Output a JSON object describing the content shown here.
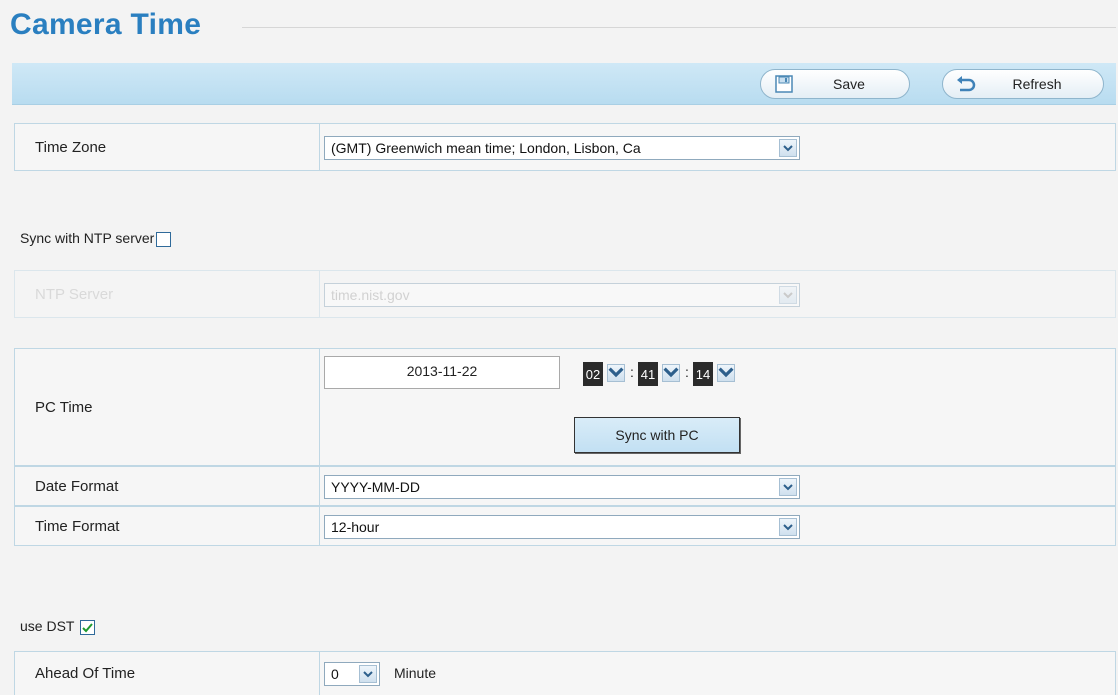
{
  "title": "Camera Time",
  "toolbar": {
    "save_label": "Save",
    "refresh_label": "Refresh"
  },
  "time_zone": {
    "label": "Time Zone",
    "value": "(GMT) Greenwich mean time; London, Lisbon, Ca"
  },
  "sync_ntp": {
    "label": "Sync with NTP server",
    "checked": false
  },
  "ntp_server": {
    "label": "NTP Server",
    "value": "time.nist.gov",
    "disabled": true
  },
  "pc_time": {
    "label": "PC Time",
    "date": "2013-11-22",
    "hour": "02",
    "minute": "41",
    "second": "14",
    "sync_button": "Sync with PC"
  },
  "date_format": {
    "label": "Date Format",
    "value": "YYYY-MM-DD"
  },
  "time_format": {
    "label": "Time Format",
    "value": "12-hour"
  },
  "use_dst": {
    "label": "use DST",
    "checked": true
  },
  "ahead_of_time": {
    "label": "Ahead Of Time",
    "value": "0",
    "unit": "Minute"
  }
}
